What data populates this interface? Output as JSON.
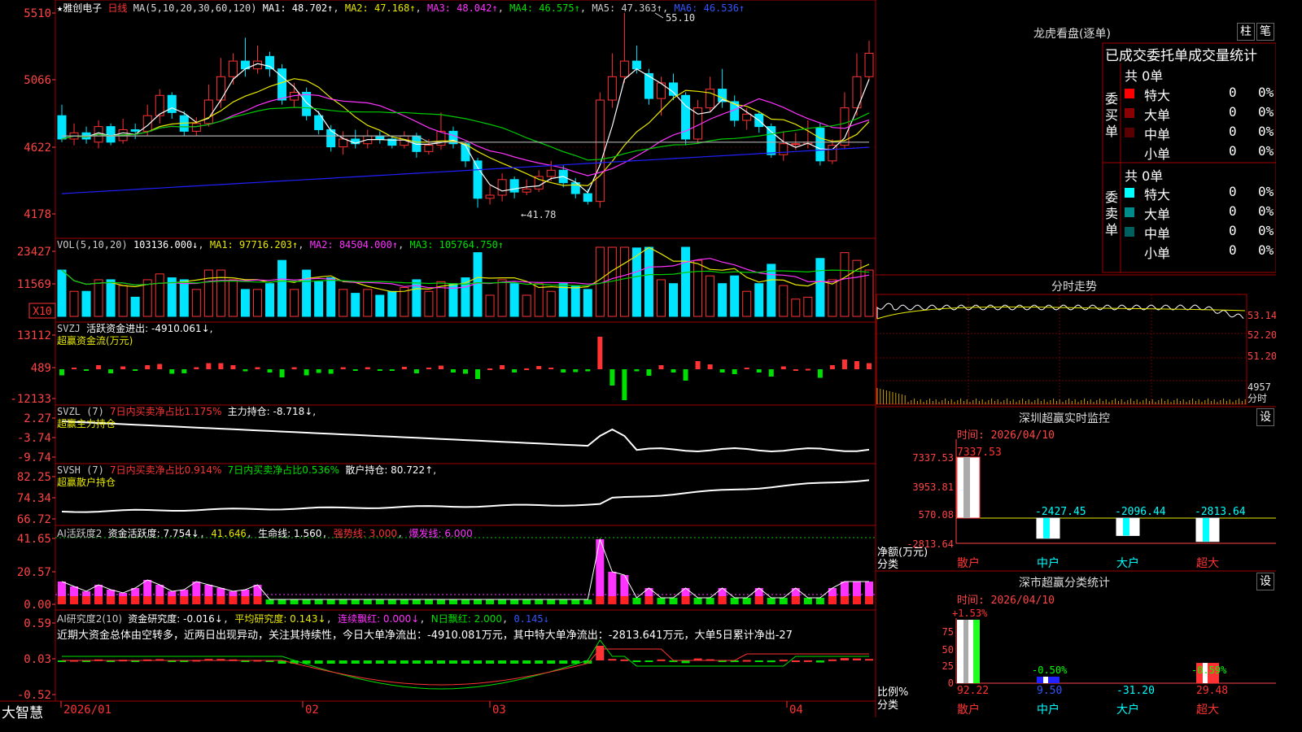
{
  "stock": {
    "name": "雅创电子",
    "period": "日线"
  },
  "colors": {
    "up": "#ff3333",
    "down": "#00e5ff",
    "bg": "#000000",
    "grid": "#8b0000",
    "axis": "#ff3b3b",
    "ma1": "#ffffff",
    "ma2": "#e8e800",
    "ma3": "#ff33ff",
    "ma4": "#00cc00",
    "ma5": "#b0b0b0",
    "ma6": "#2020ff",
    "green": "#00e000",
    "magenta": "#ff33ff"
  },
  "price_panel": {
    "header": {
      "ma_label": "MA(5,10,20,30,60,120)",
      "ma1": "MA1: 48.702↑",
      "ma2": "MA2: 47.168↑",
      "ma3": "MA3: 48.042↑",
      "ma4": "MA4: 46.575↑",
      "ma5": "MA5: 47.363↑",
      "ma6": "MA6: 46.536↑"
    },
    "y_ticks": [
      "5510",
      "5066",
      "4622",
      "4178"
    ],
    "high_label": "55.10",
    "low_label": "41.78",
    "ylim": [
      41.0,
      55.5
    ]
  },
  "vol_panel": {
    "header": {
      "label": "VOL(5,10,20)",
      "vol": "103136.000↓",
      "ma1": "MA1: 97716.203↑",
      "ma2": "MA2: 84504.000↑",
      "ma3": "MA3: 105764.750↑"
    },
    "y_ticks": [
      "23427",
      "11569"
    ],
    "unit": "X10"
  },
  "svzj_panel": {
    "header": {
      "label": "SVZJ",
      "desc": "活跃资金进出: -4910.061↓,",
      "sub": "超赢资金流(万元)"
    },
    "y_ticks": [
      "13112",
      "489",
      "-12133"
    ]
  },
  "svzl_panel": {
    "header": {
      "label": "SVZL (7)",
      "ratio": "7日内买卖净占比1.175%",
      "hold": "主力持仓: -8.718↓,",
      "sub": "超赢主力持仓"
    },
    "y_ticks": [
      "2.27",
      "-3.74",
      "-9.74"
    ]
  },
  "svsh_panel": {
    "header": {
      "label": "SVSH (7)",
      "ratio1": "7日内买卖净占比0.914%",
      "ratio2": "7日内买卖净占比0.536%",
      "hold": "散户持仓: 80.722↑,",
      "sub": "超赢散户持仓"
    },
    "y_ticks": [
      "82.25",
      "74.34",
      "66.72"
    ]
  },
  "ai_active": {
    "header": {
      "label": "AI活跃度2",
      "v1": "资金活跃度: 7.754↓",
      "v2": "41.646",
      "v3": "生命线: 1.560",
      "v4": "强势线: 3.000",
      "v5": "爆发线: 6.000"
    },
    "y_ticks": [
      "41.65",
      "20.57",
      "0.00"
    ]
  },
  "ai_research": {
    "header": {
      "label": "AI研究度2(10)",
      "v1": "资金研究度: -0.016↓",
      "v2": "平均研究度: 0.143↓",
      "v3": "连续飘红: 0.000↓",
      "v4": "N日飘红: 2.000",
      "v5": "0.145↓",
      "comment": "近期大资金总体由空转多，近两日出现异动，关注其持续性，今日大单净流出：-4910.081万元，其中特大单净流出：-2813.641万元，大单5日累计净出-27"
    },
    "y_ticks": [
      "0.59",
      "0.03",
      "-0.52"
    ]
  },
  "x_axis": {
    "labels": [
      "2026/01",
      "02",
      "03",
      "04"
    ]
  },
  "brand": "大智慧",
  "longhu": {
    "title": "龙虎看盘(逐单)",
    "btn1": "柱",
    "btn2": "笔",
    "tabs": "已成交委托单成交量统计",
    "buy": {
      "side": "委买单",
      "total": "共 0单",
      "rows": [
        {
          "label": "特大",
          "count": "0",
          "pct": "0%",
          "color": "#ff0000"
        },
        {
          "label": "大单",
          "count": "0",
          "pct": "0%",
          "color": "#8b0000"
        },
        {
          "label": "中单",
          "count": "0",
          "pct": "0%",
          "color": "#5a0000"
        },
        {
          "label": "小单",
          "count": "0",
          "pct": "0%",
          "color": "#000000"
        }
      ]
    },
    "sell": {
      "side": "委卖单",
      "total": "共 0单",
      "rows": [
        {
          "label": "特大",
          "count": "0",
          "pct": "0%",
          "color": "#00ffff"
        },
        {
          "label": "大单",
          "count": "0",
          "pct": "0%",
          "color": "#008b8b"
        },
        {
          "label": "中单",
          "count": "0",
          "pct": "0%",
          "color": "#006060"
        },
        {
          "label": "小单",
          "count": "0",
          "pct": "0%",
          "color": "#000000"
        }
      ]
    }
  },
  "intraday": {
    "title": "分时走势",
    "y_ticks": [
      "53.14",
      "52.20",
      "51.20"
    ],
    "vol_tick": "4957",
    "vol_unit": "分时"
  },
  "monitor": {
    "title": "深圳超赢实时监控",
    "set": "设",
    "time": "时间: 2026/04/10",
    "ylabel": "净额(万元)",
    "xlabel": "分类",
    "y_ticks": [
      "7337.53",
      "3953.81",
      "570.08",
      "-2813.64"
    ],
    "chart_data": {
      "type": "bar",
      "categories": [
        "散户",
        "中户",
        "大户",
        "超大"
      ],
      "values": [
        7337.53,
        -2427.45,
        -2096.44,
        -2813.64
      ],
      "labels": [
        "7337.53",
        "-2427.45",
        "-2096.44",
        "-2813.64"
      ],
      "ylim": [
        -2813.64,
        7337.53
      ]
    }
  },
  "classify": {
    "title": "深市超赢分类统计",
    "set": "设",
    "time": "时间: 2026/04/10",
    "ylabel": "比例%",
    "xlabel": "分类",
    "y_ticks": [
      "75",
      "50",
      "25",
      "0"
    ],
    "chart_data": {
      "type": "bar",
      "categories": [
        "散户",
        "中户",
        "大户",
        "超大"
      ],
      "values": [
        92.22,
        9.5,
        -31.2,
        29.48
      ],
      "pct": [
        "+1.53%",
        "-0.50%",
        "",
        "-0.59%"
      ],
      "ylim": [
        0,
        92.22
      ]
    }
  },
  "candles": [
    [
      48.5,
      47.0,
      49.2,
      46.8
    ],
    [
      47.0,
      47.4,
      48.0,
      46.6
    ],
    [
      47.4,
      47.0,
      47.8,
      46.7
    ],
    [
      46.8,
      47.8,
      48.2,
      46.4
    ],
    [
      47.8,
      46.8,
      48.0,
      46.6
    ],
    [
      46.9,
      47.6,
      48.3,
      46.7
    ],
    [
      47.6,
      47.5,
      48.0,
      47.0
    ],
    [
      47.5,
      48.5,
      49.2,
      47.2
    ],
    [
      48.5,
      49.8,
      50.2,
      48.0
    ],
    [
      49.8,
      48.7,
      50.0,
      48.3
    ],
    [
      48.5,
      47.5,
      48.8,
      47.2
    ],
    [
      47.5,
      48.0,
      48.4,
      47.2
    ],
    [
      48.0,
      49.5,
      50.5,
      47.8
    ],
    [
      49.5,
      51.0,
      52.2,
      49.0
    ],
    [
      51.0,
      52.0,
      52.5,
      50.5
    ],
    [
      52.0,
      51.5,
      53.5,
      51.0
    ],
    [
      51.5,
      52.0,
      53.0,
      51.2
    ],
    [
      52.3,
      51.5,
      52.6,
      51.0
    ],
    [
      51.5,
      49.5,
      51.8,
      49.2
    ],
    [
      49.5,
      50.0,
      50.6,
      49.0
    ],
    [
      50.0,
      48.5,
      50.3,
      48.2
    ],
    [
      48.5,
      47.6,
      48.8,
      47.3
    ],
    [
      47.6,
      46.5,
      47.9,
      46.2
    ],
    [
      46.5,
      47.0,
      47.5,
      46.0
    ],
    [
      47.0,
      46.7,
      47.6,
      46.4
    ],
    [
      46.7,
      47.2,
      47.6,
      46.4
    ],
    [
      47.2,
      47.0,
      47.5,
      46.7
    ],
    [
      47.0,
      46.6,
      47.2,
      46.4
    ],
    [
      46.6,
      47.2,
      47.5,
      46.4
    ],
    [
      47.2,
      46.2,
      47.4,
      45.8
    ],
    [
      46.2,
      46.6,
      47.0,
      46.0
    ],
    [
      46.6,
      47.5,
      48.7,
      46.3
    ],
    [
      47.5,
      46.7,
      47.8,
      46.4
    ],
    [
      46.7,
      45.6,
      46.8,
      45.2
    ],
    [
      45.6,
      43.2,
      45.8,
      42.6
    ],
    [
      43.2,
      43.4,
      44.0,
      42.8
    ],
    [
      43.4,
      44.4,
      44.8,
      43.0
    ],
    [
      44.4,
      43.6,
      44.6,
      43.2
    ],
    [
      43.6,
      43.8,
      44.4,
      43.4
    ],
    [
      43.8,
      44.6,
      45.0,
      43.6
    ],
    [
      44.6,
      45.0,
      45.6,
      44.3
    ],
    [
      45.0,
      44.2,
      45.3,
      43.9
    ],
    [
      44.2,
      43.5,
      44.5,
      43.2
    ],
    [
      43.5,
      43.0,
      43.8,
      42.8
    ],
    [
      43.0,
      49.5,
      50.0,
      42.6
    ],
    [
      49.5,
      51.0,
      52.5,
      49.0
    ],
    [
      51.0,
      52.0,
      55.1,
      50.6
    ],
    [
      52.0,
      51.5,
      53.0,
      51.2
    ],
    [
      51.2,
      49.6,
      51.5,
      49.2
    ],
    [
      49.6,
      50.6,
      51.0,
      48.5
    ],
    [
      50.6,
      49.8,
      51.2,
      49.5
    ],
    [
      49.8,
      47.0,
      50.0,
      46.6
    ],
    [
      47.0,
      49.0,
      49.5,
      46.7
    ],
    [
      49.0,
      50.2,
      51.0,
      48.8
    ],
    [
      50.2,
      49.4,
      51.5,
      49.0
    ],
    [
      49.4,
      48.2,
      49.8,
      47.8
    ],
    [
      48.2,
      48.6,
      49.0,
      47.6
    ],
    [
      48.6,
      47.8,
      48.8,
      47.4
    ],
    [
      47.8,
      46.0,
      48.0,
      45.8
    ],
    [
      46.0,
      46.7,
      47.5,
      45.6
    ],
    [
      46.7,
      46.7,
      47.4,
      46.3
    ],
    [
      46.7,
      46.8,
      48.2,
      46.4
    ],
    [
      47.7,
      45.6,
      48.0,
      45.3
    ],
    [
      45.6,
      46.6,
      47.0,
      45.4
    ],
    [
      46.6,
      49.0,
      50.0,
      46.4
    ],
    [
      49.0,
      51.0,
      52.5,
      48.5
    ],
    [
      51.0,
      52.5,
      53.3,
      50.8
    ]
  ]
}
